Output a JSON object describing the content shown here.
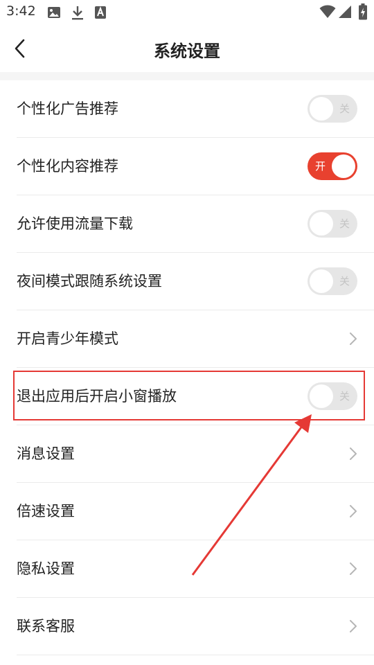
{
  "status_bar": {
    "time": "3:42",
    "left_icons": [
      "image-icon",
      "download-icon",
      "font-app-icon"
    ],
    "right_icons": [
      "wifi-icon",
      "signal-icon",
      "battery-charging-icon"
    ]
  },
  "header": {
    "title": "系统设置",
    "back_icon": "chevron-left-icon"
  },
  "settings": [
    {
      "label": "个性化广告推荐",
      "type": "toggle",
      "state": "off",
      "state_text": "关"
    },
    {
      "label": "个性化内容推荐",
      "type": "toggle",
      "state": "on",
      "state_text": "开"
    },
    {
      "label": "允许使用流量下载",
      "type": "toggle",
      "state": "off",
      "state_text": "关"
    },
    {
      "label": "夜间模式跟随系统设置",
      "type": "toggle",
      "state": "off",
      "state_text": "关"
    },
    {
      "label": "开启青少年模式",
      "type": "link"
    },
    {
      "label": "退出应用后开启小窗播放",
      "type": "toggle",
      "state": "off",
      "state_text": "关"
    },
    {
      "label": "消息设置",
      "type": "link"
    },
    {
      "label": "倍速设置",
      "type": "link"
    },
    {
      "label": "隐私设置",
      "type": "link"
    },
    {
      "label": "联系客服",
      "type": "link"
    }
  ],
  "colors": {
    "accent": "#e8412f",
    "toggle_off": "#e6e6e6",
    "annotation": "#e53935"
  }
}
